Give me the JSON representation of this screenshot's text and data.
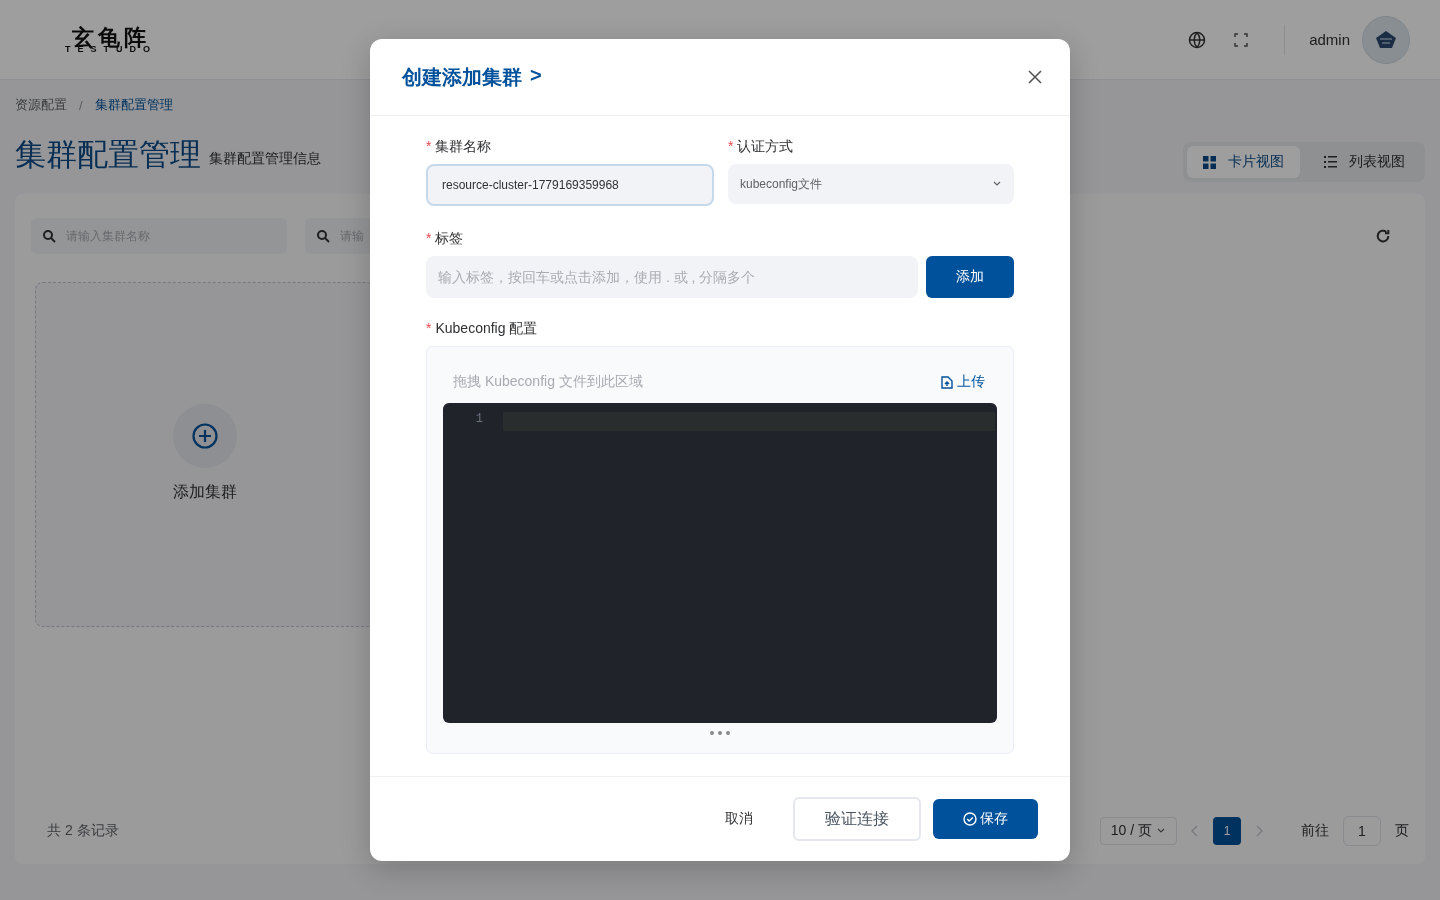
{
  "header": {
    "logo_cn": "玄龟阵",
    "logo_en": "TESTUDO",
    "user": "admin"
  },
  "breadcrumb": [
    {
      "label": "资源配置",
      "selected": false
    },
    {
      "label": "集群配置管理",
      "selected": true
    }
  ],
  "breadcrumb_separator": "/",
  "page": {
    "title": "集群配置管理",
    "subtitle": "集群配置管理信息"
  },
  "view_toggle": [
    {
      "label": "卡片视图",
      "selected": true,
      "kind": "grid"
    },
    {
      "label": "列表视图",
      "selected": false,
      "kind": "list"
    }
  ],
  "filters": [
    {
      "placeholder": "请输入集群名称"
    },
    {
      "placeholder": "请输"
    }
  ],
  "add_card": {
    "label": "添加集群"
  },
  "footer": {
    "total": "共 2 条记录",
    "page_size": "10 / 页",
    "pages": [
      {
        "label": "1",
        "selected": true
      }
    ],
    "goto_label": "前往",
    "goto_value": "1",
    "page_suffix": "页"
  },
  "dialog": {
    "title": "创建添加集群",
    "title_arrow": ">",
    "required_mark": "*",
    "fields": [
      {
        "label": "集群名称",
        "required": true,
        "value": "resource-cluster-1779169359968",
        "focused": true
      },
      {
        "label": "认证方式",
        "required": true,
        "value": "kubeconfig文件"
      }
    ],
    "tags": {
      "label": "标签",
      "required": true,
      "placeholder": "输入标签，按回车或点击添加，使用 . 或 , 分隔多个",
      "button": "添加"
    },
    "kubeconfig": {
      "label": "Kubeconfig 配置",
      "required": true,
      "drop_hint": "拖拽 Kubeconfig 文件到此区域",
      "upload": "上传",
      "line_numbers": [
        "1"
      ]
    },
    "buttons": [
      {
        "label": "取消",
        "kind": "text"
      },
      {
        "label": "验证连接",
        "kind": "outline"
      },
      {
        "label": "保存",
        "kind": "primary"
      }
    ]
  }
}
